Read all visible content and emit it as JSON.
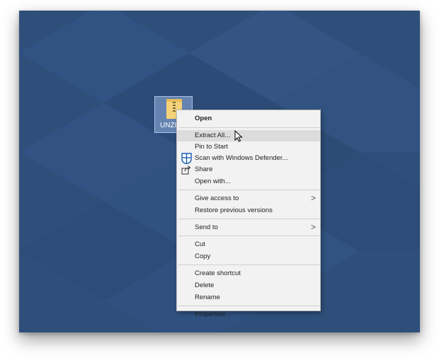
{
  "desktop": {
    "background_color": "#2f4f7b",
    "file": {
      "label": "UNZIP",
      "icon": "zip-folder-icon"
    }
  },
  "context_menu": {
    "open": "Open",
    "extract_all": "Extract All...",
    "pin_to_start": "Pin to Start",
    "scan_defender": "Scan with Windows Defender...",
    "share": "Share",
    "open_with": "Open with...",
    "give_access": "Give access to",
    "restore_versions": "Restore previous versions",
    "send_to": "Send to",
    "cut": "Cut",
    "copy": "Copy",
    "create_shortcut": "Create shortcut",
    "delete": "Delete",
    "rename": "Rename",
    "properties": "Properties",
    "submenu_arrow": ">",
    "hovered_item": "Extract All..."
  }
}
